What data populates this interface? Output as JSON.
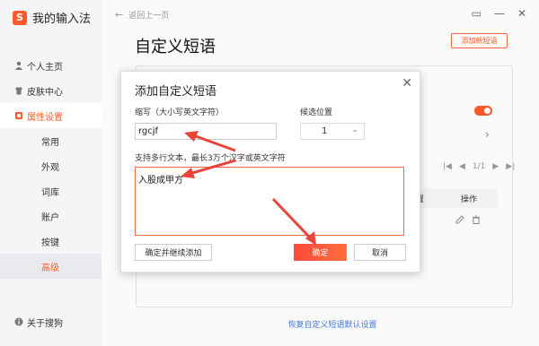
{
  "app": {
    "logo_char": "S",
    "title": "我的输入法"
  },
  "topbar": {
    "back_label": "返回上一页"
  },
  "sidebar": {
    "items": [
      {
        "label": "个人主页"
      },
      {
        "label": "皮肤中心"
      },
      {
        "label": "属性设置"
      }
    ],
    "sub_items": [
      {
        "label": "常用"
      },
      {
        "label": "外观"
      },
      {
        "label": "词库"
      },
      {
        "label": "账户"
      },
      {
        "label": "按键"
      },
      {
        "label": "高级"
      }
    ],
    "about": "关于搜狗"
  },
  "page": {
    "title": "自定义短语",
    "add_button": "添加新短语",
    "pager": "1/1",
    "table_headers": {
      "position": "位置",
      "operation": "操作"
    },
    "restore_link": "恢复自定义短语默认设置"
  },
  "dialog": {
    "title": "添加自定义短语",
    "abbr_label": "缩写（大小写英文字符）",
    "abbr_value": "rgcjf",
    "position_label": "候选位置",
    "position_value": "1",
    "text_label": "支持多行文本，最长3万个汉字或英文字符",
    "text_value": "入股成甲方",
    "btn_continue": "确定并继续添加",
    "btn_ok": "确定",
    "btn_cancel": "取消"
  },
  "colors": {
    "accent": "#ff5a2a",
    "arrow": "#e8443a",
    "link": "#4a7bd8"
  }
}
